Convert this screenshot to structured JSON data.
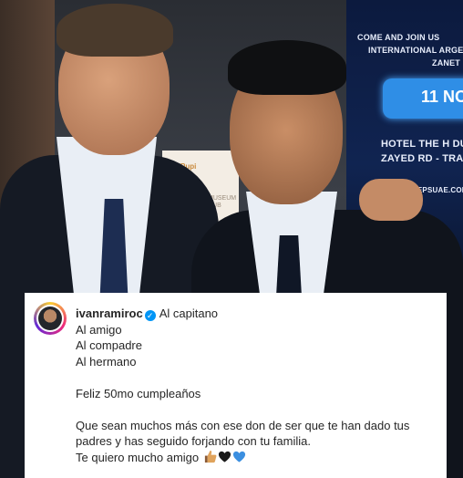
{
  "post": {
    "username": "ivanramiroc",
    "caption_first": "Al capitano",
    "lines": [
      "Al amigo",
      "Al compadre",
      "Al hermano"
    ],
    "line_birthday": "Feliz 50mo cumpleaños",
    "line_wish_1": "Que sean muchos más con ese don de ser que te han dado tus",
    "line_wish_2": "padres y has seguido forjando con tu familia.",
    "line_love": "Te quiero mucho amigo"
  },
  "photo": {
    "screen_lines": [
      "COME AND JOIN US",
      "INTERNATIONAL ARGE",
      "ZANET",
      "HOTEL THE H DU",
      "ZAYED RD - TRA",
      "INFO@REPSUAE.COM"
    ],
    "screen_date": "11 NO",
    "banner_logo": "Pupi",
    "banner_text": "MUSEUM HUB"
  },
  "icons": {
    "verified": "verified-badge-icon",
    "thumbs": "thumbs-up-icon",
    "black_heart": "black-heart-icon",
    "blue_heart": "blue-heart-icon"
  },
  "colors": {
    "verified_blue": "#0095f6",
    "blue_heart": "#3b8fe0"
  }
}
